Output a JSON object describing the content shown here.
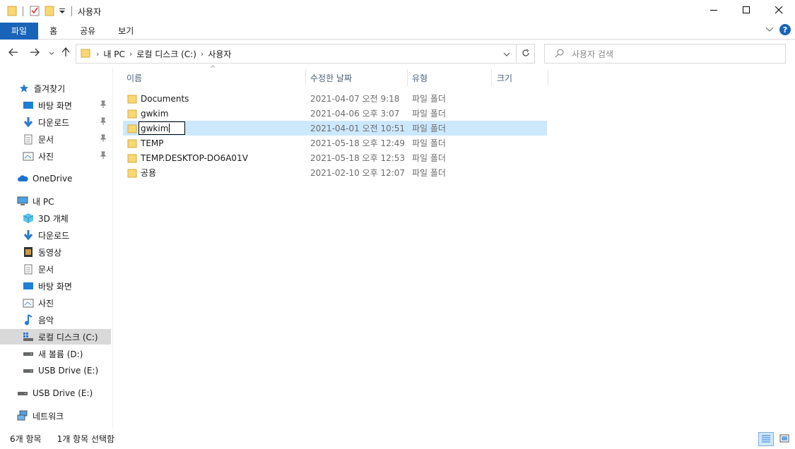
{
  "window": {
    "title": "사용자",
    "minimize_icon": "minimize-icon",
    "maximize_icon": "maximize-icon",
    "close_icon": "close-icon"
  },
  "ribbon": {
    "tabs": [
      {
        "label": "파일",
        "active": true
      },
      {
        "label": "홈"
      },
      {
        "label": "공유"
      },
      {
        "label": "보기"
      }
    ]
  },
  "address": {
    "crumbs": [
      "내 PC",
      "로컬 디스크 (C:)",
      "사용자"
    ]
  },
  "search": {
    "placeholder": "사용자 검색"
  },
  "sidebar": {
    "items": [
      {
        "label": "즐겨찾기",
        "icon": "star-icon"
      },
      {
        "label": "바탕 화면",
        "icon": "desktop-icon",
        "pinned": true
      },
      {
        "label": "다운로드",
        "icon": "download-icon",
        "pinned": true
      },
      {
        "label": "문서",
        "icon": "document-icon",
        "pinned": true
      },
      {
        "label": "사진",
        "icon": "picture-icon",
        "pinned": true
      },
      {
        "label": "OneDrive",
        "icon": "cloud-icon"
      },
      {
        "label": "내 PC",
        "icon": "computer-icon"
      },
      {
        "label": "3D 개체",
        "icon": "cube-icon"
      },
      {
        "label": "다운로드",
        "icon": "download-icon"
      },
      {
        "label": "동영상",
        "icon": "video-icon"
      },
      {
        "label": "문서",
        "icon": "document-icon"
      },
      {
        "label": "바탕 화면",
        "icon": "desktop-icon"
      },
      {
        "label": "사진",
        "icon": "picture-icon"
      },
      {
        "label": "음악",
        "icon": "music-icon"
      },
      {
        "label": "로컬 디스크 (C:)",
        "icon": "drive-icon",
        "selected": true
      },
      {
        "label": "새 볼륨 (D:)",
        "icon": "drive-icon"
      },
      {
        "label": "USB Drive (E:)",
        "icon": "drive-icon"
      },
      {
        "label": "USB Drive (E:)",
        "icon": "drive-icon"
      },
      {
        "label": "네트워크",
        "icon": "network-icon"
      }
    ]
  },
  "columns": {
    "name": "이름",
    "modified": "수정한 날짜",
    "type": "유형",
    "size": "크기"
  },
  "files": [
    {
      "name": "Documents",
      "modified": "2021-04-07 오전 9:18",
      "type": "파일 폴더"
    },
    {
      "name": "gwkim",
      "modified": "2021-04-06 오후 3:07",
      "type": "파일 폴더"
    },
    {
      "name": "gwkim",
      "modified": "2021-04-01 오전 10:51",
      "type": "파일 폴더",
      "selected": true,
      "renaming": true
    },
    {
      "name": "TEMP",
      "modified": "2021-05-18 오후 12:49",
      "type": "파일 폴더"
    },
    {
      "name": "TEMP.DESKTOP-DO6A01V",
      "modified": "2021-05-18 오후 12:53",
      "type": "파일 폴더"
    },
    {
      "name": "공용",
      "modified": "2021-02-10 오후 12:07",
      "type": "파일 폴더"
    }
  ],
  "status": {
    "count": "6개 항목",
    "selection": "1개 항목 선택함"
  },
  "colors": {
    "accent": "#1964b9",
    "selection": "#cce8ff",
    "folder": "#f8d775"
  }
}
